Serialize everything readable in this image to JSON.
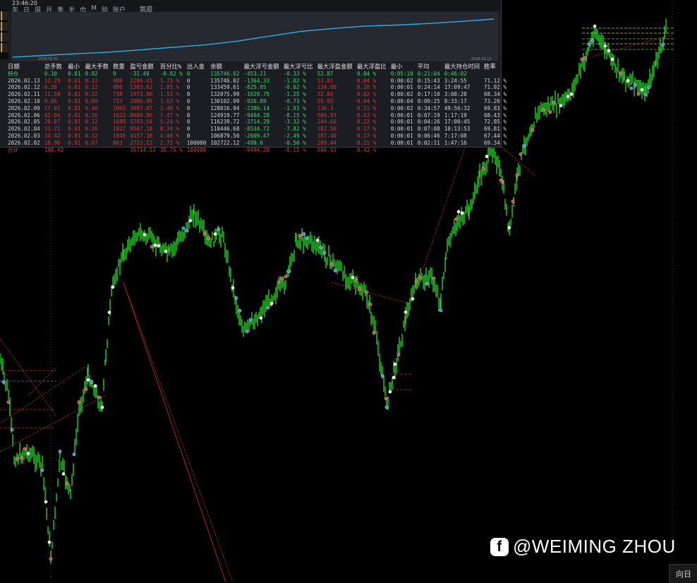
{
  "panel": {
    "clock": "23:46:20",
    "tabs": [
      "年",
      "日",
      "周",
      "月",
      "季",
      "半",
      "巾",
      "M",
      "验",
      "账户"
    ],
    "title": "氛迎",
    "equity": {
      "start_label": "2026.02.02",
      "end_label": "2026.02.13",
      "line_color": "#2ab0e8",
      "values": [
        0.1,
        2.6,
        5.2,
        7.5,
        11.0,
        14.8,
        18.4,
        24.0,
        31.5,
        38.6,
        43.0,
        46.5,
        48.0,
        50.5,
        53.5,
        57.0
      ]
    },
    "columns": [
      "日期",
      "总手数",
      "最小",
      "最大手数",
      "数量",
      "盈亏金额",
      "百分比%",
      "出入金",
      "余额",
      "最大浮亏金额",
      "最大浮亏比",
      "最大浮盈金额",
      "最大浮盈比",
      "最小",
      "平均",
      "最大持仓时间",
      "胜率"
    ],
    "hold": {
      "label": "持仓",
      "vals": [
        "0.10",
        "0.01",
        "0.02",
        "9",
        "-31.49",
        "-0.02 %",
        "0",
        "135746.02",
        "-453.21",
        "-0.33 %",
        "52.87",
        "0.04 %",
        "0:05:10",
        "0:21:04",
        "0:46:02",
        ""
      ]
    },
    "rows": [
      {
        "date": "2026.02.13",
        "lots": "12.29",
        "min": "0.01",
        "max": "0.13",
        "count": "980",
        "pnl": "2286.41",
        "pct": "1.73 %",
        "io": "0",
        "bal": "135746.02",
        "mfl": "-1364.33",
        "mflp": "-1.02 %",
        "mfp": "53.81",
        "mfpp": "0.04 %",
        "tmin": "0:00:02",
        "tavg": "0:15:43",
        "tmax": "3:24:55",
        "win": "71.12 %"
      },
      {
        "date": "2026.02.12",
        "lots": "6.36",
        "min": "0.01",
        "max": "0.12",
        "count": "490",
        "pnl": "1383.62",
        "pct": "1.05 %",
        "io": "0",
        "bal": "133459.61",
        "mfl": "-825.05",
        "mflp": "-0.62 %",
        "mfp": "134.60",
        "mfpp": "0.10 %",
        "tmin": "0:00:01",
        "tavg": "0:24:14",
        "tmax": "17:09:47",
        "win": "71.92 %"
      },
      {
        "date": "2026.02.11",
        "lots": "11.58",
        "min": "0.01",
        "max": "0.32",
        "count": "738",
        "pnl": "1973.00",
        "pct": "1.53 %",
        "io": "0",
        "bal": "132075.99",
        "mfl": "-1629.75",
        "mflp": "-1.25 %",
        "mfp": "32.84",
        "mfpp": "0.02 %",
        "tmin": "0:00:02",
        "tavg": "0:17:10",
        "tmax": "3:08:28",
        "win": "68.34 %"
      },
      {
        "date": "2026.02.10",
        "lots": "9.86",
        "min": "0.01",
        "max": "0.09",
        "count": "733",
        "pnl": "2086.95",
        "pct": "1.63 %",
        "io": "0",
        "bal": "130102.99",
        "mfl": "-926.89",
        "mflp": "-0.71 %",
        "mfp": "55.93",
        "mfpp": "0.04 %",
        "tmin": "0:00:04",
        "tavg": "0:09:25",
        "tmax": "8:33:17",
        "win": "73.26 %"
      },
      {
        "date": "2026.02.09",
        "lots": "17.01",
        "min": "0.01",
        "max": "0.46",
        "count": "1062",
        "pnl": "3897.07",
        "pct": "3.49 %",
        "io": "0",
        "bal": "128016.94",
        "mfl": "-2386.14",
        "mflp": "-1.91 %",
        "mfp": "136.3",
        "mfpp": "0.11 %",
        "tmin": "0:00:02",
        "tavg": "0:34:57",
        "tmax": "49:56:32",
        "win": "69.83 %"
      },
      {
        "date": "2026.02.06",
        "lots": "42.66",
        "min": "0.01",
        "max": "0.16",
        "count": "1623",
        "pnl": "8680.06",
        "pct": "7.47 %",
        "io": "0",
        "bal": "124919.77",
        "mfl": "-9494.28",
        "mflp": "-8.15 %",
        "mfp": "506.93",
        "mfpp": "0.43 %",
        "tmin": "0:00:01",
        "tavg": "0:07:19",
        "tmax": "1:17:19",
        "win": "68.43 %"
      },
      {
        "date": "2026.02.05",
        "lots": "29.87",
        "min": "0.01",
        "max": "0.12",
        "count": "1689",
        "pnl": "5793.54",
        "pct": "5.24 %",
        "io": "0",
        "bal": "116239.72",
        "mfl": "-3714.29",
        "mflp": "-3.32 %",
        "mfp": "244.60",
        "mfpp": "0.22 %",
        "tmin": "0:00:01",
        "tavg": "0:04:26",
        "tmax": "17:00:45",
        "win": "72.85 %"
      },
      {
        "date": "2026.02.04",
        "lots": "33.71",
        "min": "0.01",
        "max": "0.26",
        "count": "1827",
        "pnl": "9567.18",
        "pct": "8.24 %",
        "io": "0",
        "bal": "110446.68",
        "mfl": "-8534.72",
        "mflp": "-7.82 %",
        "mfp": "182.50",
        "mfpp": "0.17 %",
        "tmin": "0:00:01",
        "tavg": "0:07:08",
        "tmax": "10:13:53",
        "win": "69.81 %"
      },
      {
        "date": "2026.02.03",
        "lots": "34.42",
        "min": "0.01",
        "max": "0.32",
        "count": "1845",
        "pnl": "4157.38",
        "pct": "4.00 %",
        "io": "0",
        "bal": "106879.50",
        "mfl": "-2609.47",
        "mflp": "-2.49 %",
        "mfp": "187.40",
        "mfpp": "0.17 %",
        "tmin": "0:00:01",
        "tavg": "0:06:46",
        "tmax": "7:17:08",
        "win": "67.44 %"
      },
      {
        "date": "2026.02.02",
        "lots": "10.96",
        "min": "0.01",
        "max": "0.07",
        "count": "803",
        "pnl": "2722.12",
        "pct": "2.72 %",
        "io": "100000",
        "bal": "102722.12",
        "mfl": "-499.6",
        "mflp": "-0.50 %",
        "mfp": "209.44",
        "mfpp": "0.21 %",
        "tmin": "0:00:01",
        "tavg": "0:02:11",
        "tmax": "1:47:16",
        "win": "69.34 %"
      }
    ],
    "total": {
      "label": "合计",
      "vals": [
        "198.43",
        "",
        "",
        "",
        "35714.53",
        "35.75 %",
        "100000",
        "",
        "-9494.28",
        "-8.15 %",
        "506.93",
        "0.43 %",
        "",
        "",
        "",
        ""
      ]
    }
  },
  "chart": {
    "background": "#000000",
    "candle_color": "#27e027",
    "marker_colors": [
      "#d23a3a",
      "#3a86e0",
      "#ffffff"
    ],
    "trade_line_color": "#c0302a"
  },
  "watermark": {
    "icon": "facebook-icon",
    "text": "@WEIMING ZHOU"
  },
  "corner_button": "向日"
}
